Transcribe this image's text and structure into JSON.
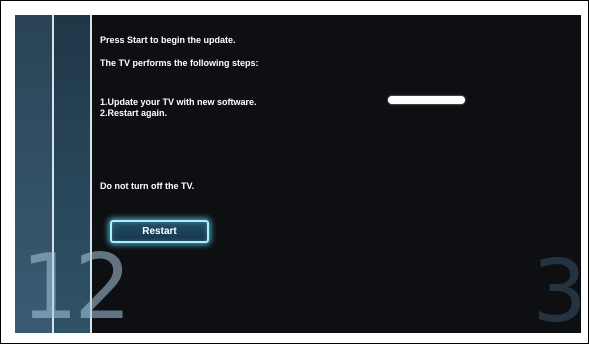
{
  "dialog": {
    "line_start": "Press Start to begin the update.",
    "line_steps_intro": "The TV performs the following steps:",
    "step_1": "1.Update your TV with new software.",
    "step_2": "2.Restart again.",
    "warning": "Do not turn off the TV.",
    "restart_label": "Restart"
  },
  "steps": {
    "current": "12",
    "next": "3"
  },
  "progress": {
    "fraction": 1.0
  },
  "colors": {
    "background": "#0d0f12",
    "rail": "#314e63",
    "button_glow": "#62d9f7",
    "text": "#ffffff"
  }
}
